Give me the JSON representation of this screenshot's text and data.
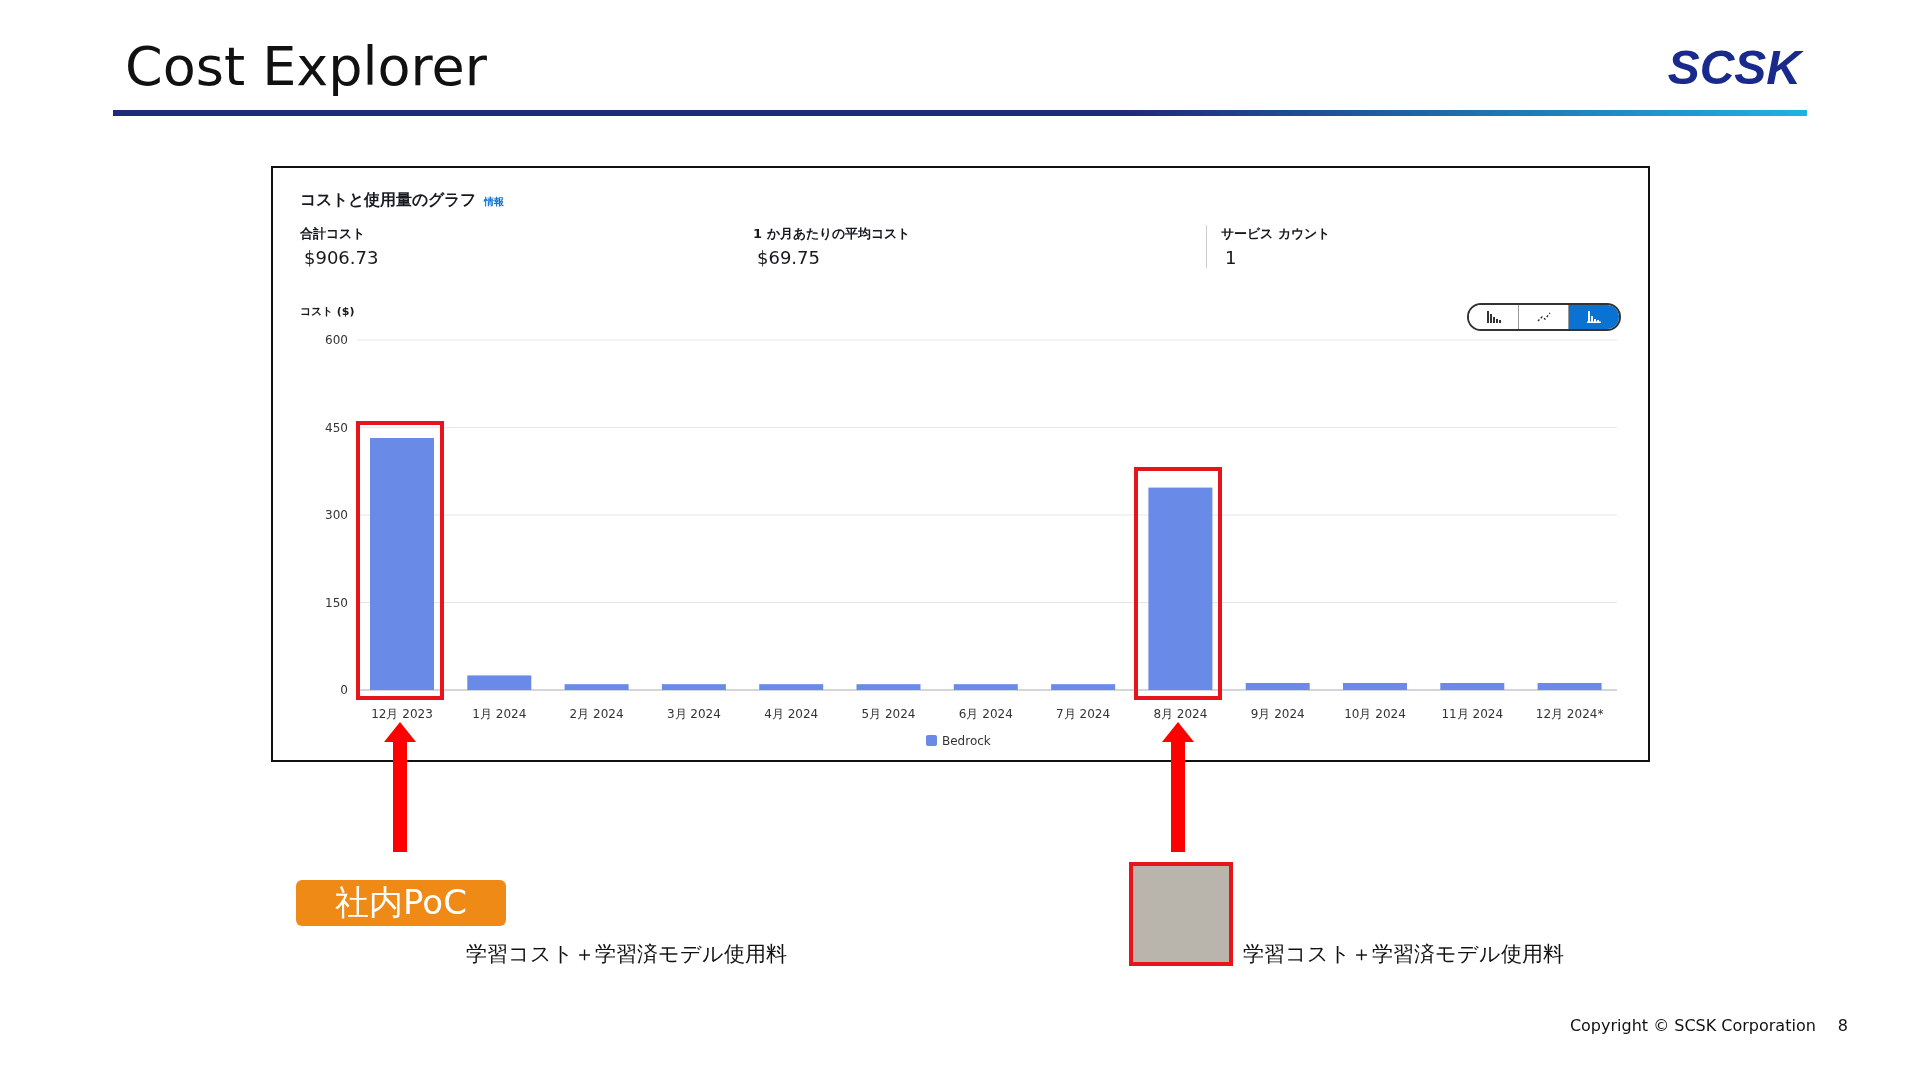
{
  "slide": {
    "title": "Cost Explorer",
    "logo": "SCSK",
    "copyright": "Copyright © SCSK Corporation",
    "page_number": "8"
  },
  "panel": {
    "title": "コストと使用量のグラフ",
    "info_link": "情報",
    "metrics": [
      {
        "label": "合計コスト",
        "value": "$906.73"
      },
      {
        "label": "1 か月あたりの平均コスト",
        "value": "$69.75"
      },
      {
        "label": "サービス カウント",
        "value": "1"
      }
    ],
    "view_toggle": [
      {
        "kind": "bar",
        "selected": false
      },
      {
        "kind": "line",
        "selected": false
      },
      {
        "kind": "stacked",
        "selected": true
      }
    ],
    "chart_data": {
      "type": "bar",
      "ylabel": "コスト ($)",
      "categories": [
        "12月 2023",
        "1月 2024",
        "2月 2024",
        "3月 2024",
        "4月 2024",
        "5月 2024",
        "6月 2024",
        "7月 2024",
        "8月 2024",
        "9月 2024",
        "10月 2024",
        "11月 2024",
        "12月 2024*"
      ],
      "series": [
        {
          "name": "Bedrock",
          "color": "#6a8ae8",
          "values": [
            432,
            25,
            10,
            10,
            10,
            10,
            10,
            10,
            347,
            12,
            12,
            12,
            12
          ]
        }
      ],
      "ylim": [
        0,
        600
      ],
      "yticks": [
        0,
        150,
        300,
        450,
        600
      ],
      "grid": true
    }
  },
  "callouts": [
    {
      "kind": "badge",
      "label": "社内PoC",
      "caption": "学習コスト＋学習済モデル使用料"
    },
    {
      "kind": "picture",
      "caption": "学習コスト＋学習済モデル使用料"
    }
  ]
}
